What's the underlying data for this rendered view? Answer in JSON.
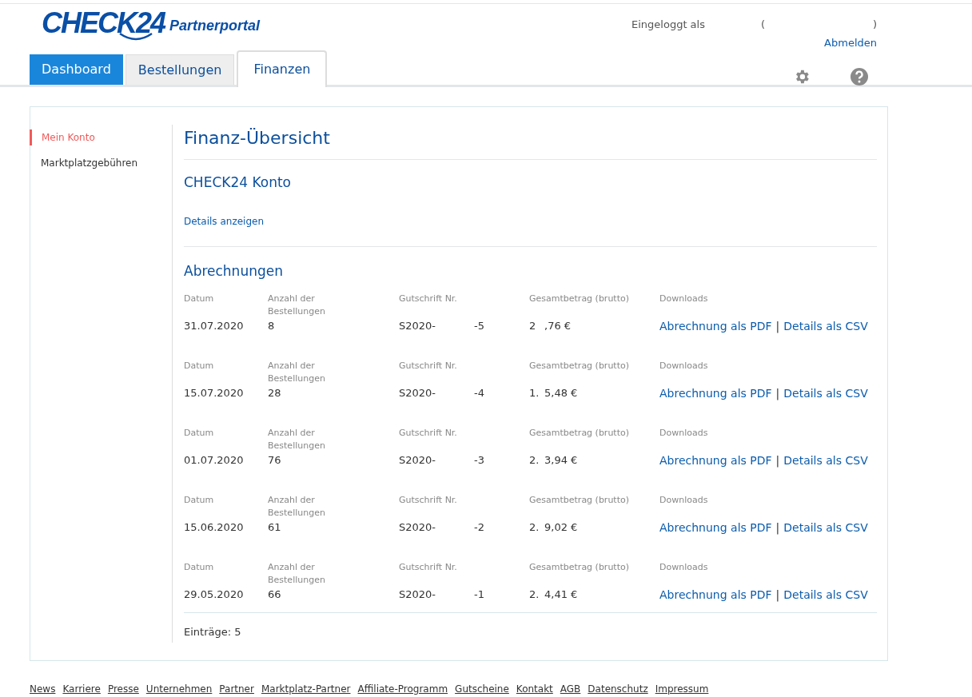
{
  "logo": {
    "brand": "CHECK24",
    "product": "Partnerportal"
  },
  "user": {
    "logged_in_label": "Eingeloggt als",
    "open_paren": "(",
    "close_paren": ")",
    "logout": "Abmelden"
  },
  "tabs": [
    {
      "label": "Dashboard",
      "kind": "primary",
      "selected": false
    },
    {
      "label": "Bestellungen",
      "kind": "plain",
      "selected": false
    },
    {
      "label": "Finanzen",
      "kind": "plain",
      "selected": true
    }
  ],
  "sidebar": {
    "items": [
      {
        "label": "Mein Konto",
        "selected": true
      },
      {
        "label": "Marktplatzgebühren",
        "selected": false
      }
    ]
  },
  "main": {
    "title": "Finanz-Übersicht",
    "account": {
      "title": "CHECK24 Konto",
      "link": "Details anzeigen"
    },
    "statements": {
      "title": "Abrechnungen",
      "rows": [
        {
          "labels": [
            "Datum",
            "Anzahl der Bestellungen",
            "Gutschrift Nr.",
            "Gesamtbetrag (brutto)",
            "Downloads"
          ],
          "date": "31.07.2020",
          "orders": "8",
          "number_prefix": "S2020-",
          "number_suffix": "-5",
          "amount_prefix": "2",
          "amount_suffix": ",76 €",
          "pdf": "Abrechnung als PDF",
          "separator": "|",
          "csv": "Details als CSV"
        },
        {
          "labels": [
            "Datum",
            "Anzahl der Bestellungen",
            "Gutschrift Nr.",
            "Gesamtbetrag (brutto)",
            "Downloads"
          ],
          "date": "15.07.2020",
          "orders": "28",
          "number_prefix": "S2020-",
          "number_suffix": "-4",
          "amount_prefix": "1.",
          "amount_suffix": "5,48 €",
          "pdf": "Abrechnung als PDF",
          "separator": "|",
          "csv": "Details als CSV"
        },
        {
          "labels": [
            "Datum",
            "Anzahl der Bestellungen",
            "Gutschrift Nr.",
            "Gesamtbetrag (brutto)",
            "Downloads"
          ],
          "date": "01.07.2020",
          "orders": "76",
          "number_prefix": "S2020-",
          "number_suffix": "-3",
          "amount_prefix": "2.",
          "amount_suffix": "3,94 €",
          "pdf": "Abrechnung als PDF",
          "separator": "|",
          "csv": "Details als CSV"
        },
        {
          "labels": [
            "Datum",
            "Anzahl der Bestellungen",
            "Gutschrift Nr.",
            "Gesamtbetrag (brutto)",
            "Downloads"
          ],
          "date": "15.06.2020",
          "orders": "61",
          "number_prefix": "S2020-",
          "number_suffix": "-2",
          "amount_prefix": "2.",
          "amount_suffix": "9,02 €",
          "pdf": "Abrechnung als PDF",
          "separator": "|",
          "csv": "Details als CSV"
        },
        {
          "labels": [
            "Datum",
            "Anzahl der Bestellungen",
            "Gutschrift Nr.",
            "Gesamtbetrag (brutto)",
            "Downloads"
          ],
          "date": "29.05.2020",
          "orders": "66",
          "number_prefix": "S2020-",
          "number_suffix": "-1",
          "amount_prefix": "2.",
          "amount_suffix": "4,41 €",
          "pdf": "Abrechnung als PDF",
          "separator": "|",
          "csv": "Details als CSV"
        }
      ],
      "count": "Einträge: 5"
    }
  },
  "footer": [
    "News",
    "Karriere",
    "Presse",
    "Unternehmen",
    "Partner",
    "Marktplatz-Partner",
    "Affiliate-Programm",
    "Gutscheine",
    "Kontakt",
    "AGB",
    "Datenschutz",
    "Impressum"
  ]
}
